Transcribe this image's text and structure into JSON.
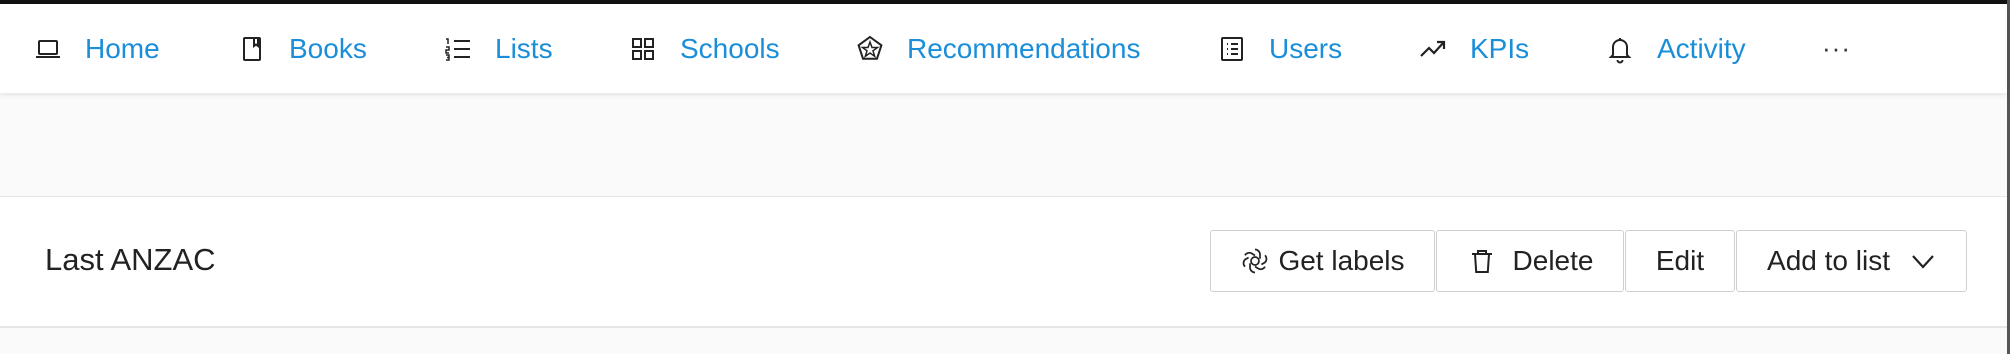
{
  "nav": {
    "items": [
      {
        "label": "Home",
        "icon": "laptop-icon"
      },
      {
        "label": "Books",
        "icon": "book-icon"
      },
      {
        "label": "Lists",
        "icon": "numbered-list-icon"
      },
      {
        "label": "Schools",
        "icon": "grid-icon"
      },
      {
        "label": "Recommendations",
        "icon": "pentagon-star-icon"
      },
      {
        "label": "Users",
        "icon": "user-list-icon"
      },
      {
        "label": "KPIs",
        "icon": "trend-up-icon"
      },
      {
        "label": "Activity",
        "icon": "bell-icon"
      }
    ],
    "more_label": "···"
  },
  "record": {
    "title": "Last ANZAC"
  },
  "actions": {
    "get_labels": "Get labels",
    "delete": "Delete",
    "edit": "Edit",
    "add_to_list": "Add to list"
  },
  "colors": {
    "link": "#1a8ed9",
    "text": "#222222",
    "border": "#cfcfcf"
  }
}
